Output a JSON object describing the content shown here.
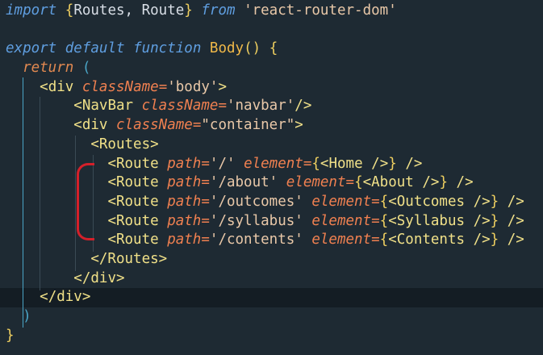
{
  "editor": {
    "lines": [
      {
        "tokens": [
          [
            "kw",
            "import"
          ],
          [
            "plain",
            " "
          ],
          [
            "brace",
            "{"
          ],
          [
            "plain",
            "Routes, Route"
          ],
          [
            "brace",
            "}"
          ],
          [
            "plain",
            " "
          ],
          [
            "kw",
            "from"
          ],
          [
            "plain",
            " "
          ],
          [
            "str",
            "'react-router-dom'"
          ]
        ]
      },
      {
        "tokens": []
      },
      {
        "tokens": [
          [
            "kw",
            "export"
          ],
          [
            "plain",
            " "
          ],
          [
            "kw",
            "default"
          ],
          [
            "plain",
            " "
          ],
          [
            "kw",
            "function"
          ],
          [
            "plain",
            " "
          ],
          [
            "fn",
            "Body"
          ],
          [
            "brace",
            "()"
          ],
          [
            "plain",
            " "
          ],
          [
            "brace",
            "{"
          ]
        ]
      },
      {
        "tokens": [
          [
            "plain",
            "  "
          ],
          [
            "kw2",
            "return"
          ],
          [
            "plain",
            " "
          ],
          [
            "par",
            "("
          ]
        ]
      },
      {
        "tokens": [
          [
            "plain",
            "    "
          ],
          [
            "tag",
            "<div"
          ],
          [
            "plain",
            " "
          ],
          [
            "attr",
            "className"
          ],
          [
            "pun",
            "="
          ],
          [
            "str",
            "'body'"
          ],
          [
            "tag",
            ">"
          ]
        ]
      },
      {
        "tokens": [
          [
            "plain",
            "        "
          ],
          [
            "tag",
            "<NavBar"
          ],
          [
            "plain",
            " "
          ],
          [
            "attr",
            "className"
          ],
          [
            "pun",
            "="
          ],
          [
            "str",
            "'navbar'"
          ],
          [
            "tag",
            "/>"
          ]
        ]
      },
      {
        "tokens": [
          [
            "plain",
            "        "
          ],
          [
            "tag",
            "<div"
          ],
          [
            "plain",
            " "
          ],
          [
            "attr",
            "className"
          ],
          [
            "pun",
            "="
          ],
          [
            "str",
            "\"container\""
          ],
          [
            "tag",
            ">"
          ]
        ]
      },
      {
        "tokens": [
          [
            "plain",
            "          "
          ],
          [
            "tag",
            "<Routes>"
          ]
        ]
      },
      {
        "tokens": [
          [
            "plain",
            "            "
          ],
          [
            "tag",
            "<Route"
          ],
          [
            "plain",
            " "
          ],
          [
            "attr",
            "path"
          ],
          [
            "pun",
            "="
          ],
          [
            "str",
            "'/'"
          ],
          [
            "plain",
            " "
          ],
          [
            "attr",
            "element"
          ],
          [
            "pun",
            "="
          ],
          [
            "brace",
            "{"
          ],
          [
            "tag",
            "<Home"
          ],
          [
            "plain",
            " "
          ],
          [
            "tag",
            "/>"
          ],
          [
            "brace",
            "}"
          ],
          [
            "plain",
            " "
          ],
          [
            "tag",
            "/>"
          ]
        ]
      },
      {
        "tokens": [
          [
            "plain",
            "            "
          ],
          [
            "tag",
            "<Route"
          ],
          [
            "plain",
            " "
          ],
          [
            "attr",
            "path"
          ],
          [
            "pun",
            "="
          ],
          [
            "str",
            "'/about'"
          ],
          [
            "plain",
            " "
          ],
          [
            "attr",
            "element"
          ],
          [
            "pun",
            "="
          ],
          [
            "brace",
            "{"
          ],
          [
            "tag",
            "<About"
          ],
          [
            "plain",
            " "
          ],
          [
            "tag",
            "/>"
          ],
          [
            "brace",
            "}"
          ],
          [
            "plain",
            " "
          ],
          [
            "tag",
            "/>"
          ]
        ]
      },
      {
        "tokens": [
          [
            "plain",
            "            "
          ],
          [
            "tag",
            "<Route"
          ],
          [
            "plain",
            " "
          ],
          [
            "attr",
            "path"
          ],
          [
            "pun",
            "="
          ],
          [
            "str",
            "'/outcomes'"
          ],
          [
            "plain",
            " "
          ],
          [
            "attr",
            "element"
          ],
          [
            "pun",
            "="
          ],
          [
            "brace",
            "{"
          ],
          [
            "tag",
            "<Outcomes"
          ],
          [
            "plain",
            " "
          ],
          [
            "tag",
            "/>"
          ],
          [
            "brace",
            "}"
          ],
          [
            "plain",
            " "
          ],
          [
            "tag",
            "/>"
          ]
        ]
      },
      {
        "tokens": [
          [
            "plain",
            "            "
          ],
          [
            "tag",
            "<Route"
          ],
          [
            "plain",
            " "
          ],
          [
            "attr",
            "path"
          ],
          [
            "pun",
            "="
          ],
          [
            "str",
            "'/syllabus'"
          ],
          [
            "plain",
            " "
          ],
          [
            "attr",
            "element"
          ],
          [
            "pun",
            "="
          ],
          [
            "brace",
            "{"
          ],
          [
            "tag",
            "<Syllabus"
          ],
          [
            "plain",
            " "
          ],
          [
            "tag",
            "/>"
          ],
          [
            "brace",
            "}"
          ],
          [
            "plain",
            " "
          ],
          [
            "tag",
            "/>"
          ]
        ]
      },
      {
        "tokens": [
          [
            "plain",
            "            "
          ],
          [
            "tag",
            "<Route"
          ],
          [
            "plain",
            " "
          ],
          [
            "attr",
            "path"
          ],
          [
            "pun",
            "="
          ],
          [
            "str",
            "'/contents'"
          ],
          [
            "plain",
            " "
          ],
          [
            "attr",
            "element"
          ],
          [
            "pun",
            "="
          ],
          [
            "brace",
            "{"
          ],
          [
            "tag",
            "<Contents"
          ],
          [
            "plain",
            " "
          ],
          [
            "tag",
            "/>"
          ],
          [
            "brace",
            "}"
          ],
          [
            "plain",
            " "
          ],
          [
            "tag",
            "/>"
          ]
        ]
      },
      {
        "tokens": [
          [
            "plain",
            "          "
          ],
          [
            "tag",
            "</Routes>"
          ]
        ]
      },
      {
        "tokens": [
          [
            "plain",
            "        "
          ],
          [
            "tag",
            "</div>"
          ]
        ]
      },
      {
        "tokens": [
          [
            "plain",
            "    "
          ],
          [
            "tag",
            "</div>"
          ]
        ]
      },
      {
        "tokens": [
          [
            "plain",
            "  "
          ],
          [
            "par",
            ")"
          ]
        ]
      },
      {
        "tokens": [
          [
            "brace",
            "}"
          ]
        ]
      }
    ],
    "colors": {
      "background": "#1e2a33",
      "keyword": "#5f9ee0",
      "tag": "#f0e088",
      "attribute": "#f08050",
      "string": "#e9c8a8",
      "annotation": "#d4202a"
    }
  }
}
